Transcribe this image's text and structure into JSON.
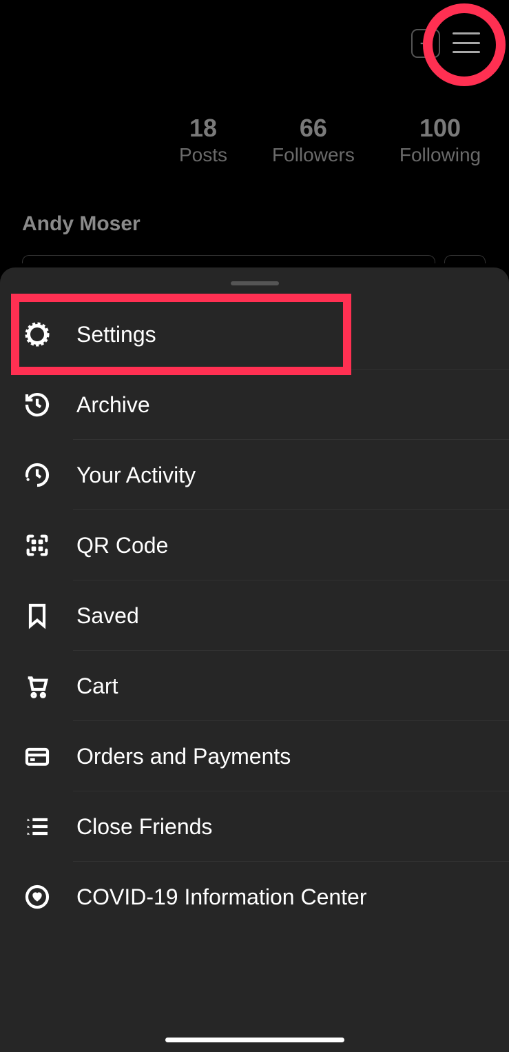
{
  "profile": {
    "stats": {
      "posts_count": "18",
      "posts_label": "Posts",
      "followers_count": "66",
      "followers_label": "Followers",
      "following_count": "100",
      "following_label": "Following"
    },
    "name": "Andy Moser"
  },
  "menu": {
    "items": [
      {
        "label": "Settings"
      },
      {
        "label": "Archive"
      },
      {
        "label": "Your Activity"
      },
      {
        "label": "QR Code"
      },
      {
        "label": "Saved"
      },
      {
        "label": "Cart"
      },
      {
        "label": "Orders and Payments"
      },
      {
        "label": "Close Friends"
      },
      {
        "label": "COVID-19 Information Center"
      }
    ]
  },
  "annotations": {
    "hamburger_highlighted": true,
    "settings_highlighted": true,
    "highlight_color": "#ff3052"
  }
}
